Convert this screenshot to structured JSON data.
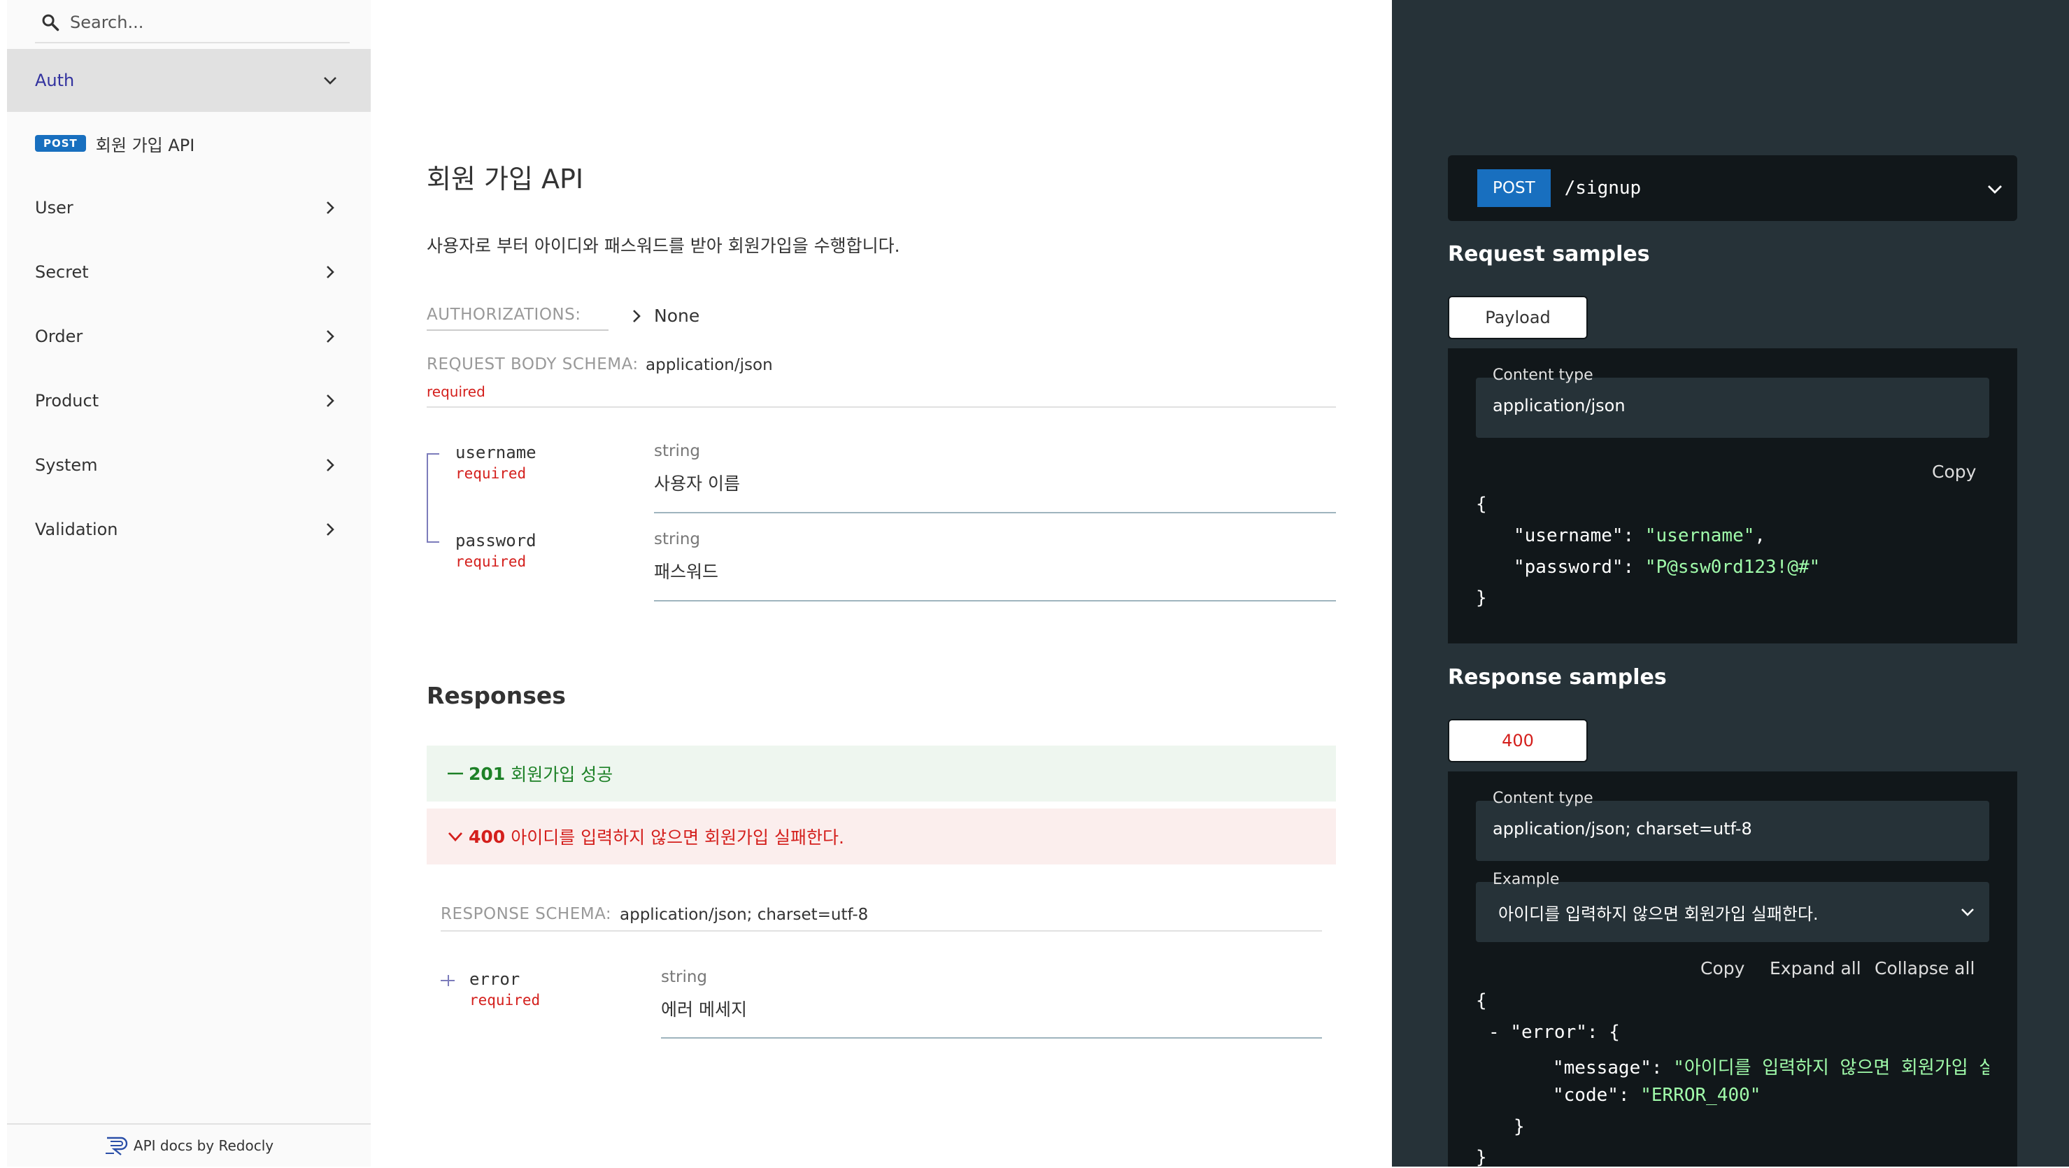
{
  "sidebar": {
    "search_placeholder": "Search...",
    "items": [
      {
        "label": "Auth"
      },
      {
        "label": "User"
      },
      {
        "label": "Secret"
      },
      {
        "label": "Order"
      },
      {
        "label": "Product"
      },
      {
        "label": "System"
      },
      {
        "label": "Validation"
      }
    ],
    "sub_item": {
      "method": "POST",
      "label": "회원 가입 API"
    },
    "footer": "API docs by Redocly"
  },
  "operation": {
    "title": "회원 가입 API",
    "description": "사용자로 부터 아이디와 패스워드를 받아 회원가입을 수행합니다.",
    "authorizations_label": "AUTHORIZATIONS:",
    "authorizations_value": "None",
    "request_body_label": "REQUEST BODY SCHEMA:",
    "request_body_value": "application/json",
    "request_body_required": "required",
    "fields": [
      {
        "name": "username",
        "required": "required",
        "type": "string",
        "description": "사용자 이름"
      },
      {
        "name": "password",
        "required": "required",
        "type": "string",
        "description": "패스워드"
      }
    ],
    "responses_title": "Responses",
    "responses": [
      {
        "code": "201",
        "description": "회원가입 성공"
      },
      {
        "code": "400",
        "description": "아이디를 입력하지 않으면 회원가입 실패한다."
      }
    ],
    "response_schema_label": "RESPONSE SCHEMA:",
    "response_schema_value": "application/json; charset=utf-8",
    "response_fields": [
      {
        "name": "error",
        "required": "required",
        "type": "string",
        "description": "에러 메세지"
      }
    ]
  },
  "right_panel": {
    "method": "POST",
    "path": "/signup",
    "request_samples_title": "Request samples",
    "request_tab": "Payload",
    "request_content_type_label": "Content type",
    "request_content_type": "application/json",
    "copy_label": "Copy",
    "request_code": {
      "open": "{",
      "username_key": "\"username\"",
      "username_value": "\"username\"",
      "password_key": "\"password\"",
      "password_value": "\"P@ssw0rd123!@#\"",
      "close": "}"
    },
    "response_samples_title": "Response samples",
    "response_tab": "400",
    "response_content_type_label": "Content type",
    "response_content_type": "application/json; charset=utf-8",
    "example_label": "Example",
    "example_value": "아이디를 입력하지 않으면 회원가입 실패한다.",
    "expand_all": "Expand all",
    "collapse_all": "Collapse all",
    "response_code": {
      "open": "{",
      "toggle": "-",
      "error_key": "\"error\"",
      "error_open": "{",
      "message_key": "\"message\"",
      "message_value": "\"아이디를 입력하지 않으면 회원가입 실패",
      "code_key": "\"code\"",
      "code_value": "\"ERROR_400\"",
      "inner_close": "}",
      "close": "}"
    }
  },
  "colors": {
    "accent": "#32329f",
    "post_badge": "#186fbf",
    "success": "#1d8127",
    "error": "#d41f1c",
    "panel_bg": "#263238",
    "panel_dark": "#11171a",
    "code_string": "#a0fbaa"
  }
}
